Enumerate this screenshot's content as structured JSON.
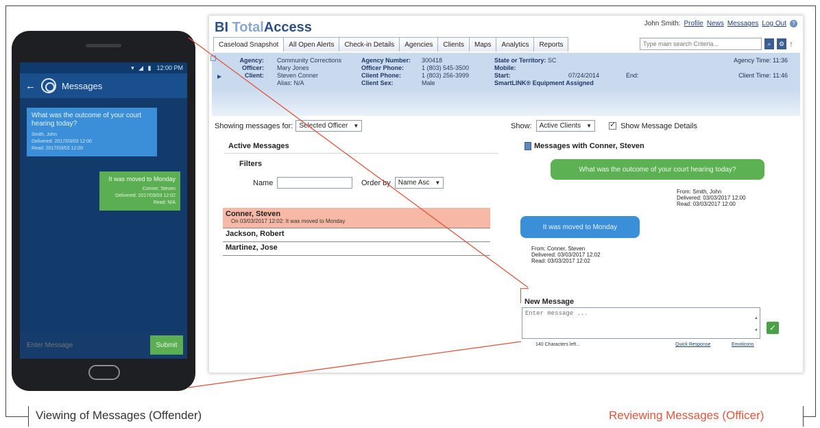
{
  "captions": {
    "left": "Viewing of Messages (Offender)",
    "right": "Reviewing Messages (Officer)"
  },
  "phone": {
    "status_time": "12:00 PM",
    "app_title": "Messages",
    "incoming": {
      "text": "What was the outcome of your court hearing today?",
      "from": "Smith, John",
      "delivered": "Delivered: 2017/03/03 12:00",
      "read": "Read: 2017/03/03 12:00"
    },
    "outgoing": {
      "text": "It was moved to Monday",
      "from": "Conner, Steven",
      "delivered": "Delivered: 2017/03/03 12:02",
      "read": "Read: N/A"
    },
    "input_placeholder": "Enter Message",
    "submit_label": "Submit"
  },
  "web": {
    "brand_bi": "BI",
    "brand_total": "Total",
    "brand_access": "Access",
    "user": {
      "name": "John Smith:",
      "links": [
        "Profile",
        "News",
        "Messages",
        "Log Out"
      ]
    },
    "tabs": [
      "Caseload Snapshot",
      "All Open Alerts",
      "Check-in Details",
      "Agencies",
      "Clients",
      "Maps",
      "Analytics",
      "Reports"
    ],
    "search_placeholder": "Type main search Criteria...",
    "header": {
      "agency_label": "Agency:",
      "agency_value": "Community Corrections",
      "officer_label": "Officer:",
      "officer_value": "Mary Jones",
      "client_label": "Client:",
      "client_value": "Steven Conner",
      "alias_value": "Alias: N/A",
      "agency_number_label": "Agency Number:",
      "agency_number_value": "300418",
      "officer_phone_label": "Officer Phone:",
      "officer_phone_value": "1 (803) 545-3500",
      "client_phone_label": "Client Phone:",
      "client_phone_value": "1 (803) 256-3999",
      "client_sex_label": "Client Sex:",
      "client_sex_value": "Male",
      "state_label": "State or Territory:",
      "state_value": "SC",
      "mobile_label": "Mobile:",
      "start_label": "Start:",
      "start_value": "07/24/2014",
      "end_label": "End:",
      "equipment": "SmartLINK® Equipment Assigned",
      "agency_time": "Agency Time: 11:36",
      "client_time": "Client Time: 11:46"
    },
    "showing_label": "Showing messages for:",
    "showing_value": "Selected Officer",
    "active_messages_title": "Active Messages",
    "filters_label": "Filters",
    "name_label": "Name",
    "order_label": "Order by",
    "order_value": "Name Asc",
    "clients": [
      {
        "name": "Conner, Steven",
        "preview": "On 03/03/2017 12:02: It was moved to Monday"
      },
      {
        "name": "Jackson, Robert",
        "preview": ""
      },
      {
        "name": "Martinez, Jose",
        "preview": ""
      }
    ],
    "show_label": "Show:",
    "show_value": "Active Clients",
    "show_details_label": "Show Message Details",
    "conversation_title": "Messages with Conner, Steven",
    "msg1": {
      "text": "What was the outcome of your court hearing today?",
      "from": "From: Smith, John",
      "delivered": "Delivered: 03/03/2017 12:00",
      "read": "Read: 03/03/2017 12:00"
    },
    "msg2": {
      "text": "It was moved to Monday",
      "from": "From: Conner, Steven",
      "delivered": "Delivered: 03/03/2017 12:02",
      "read": "Read: 03/03/2017 12:02"
    },
    "new_message_label": "New Message",
    "new_message_placeholder": "Enter message ...",
    "chars_left": "140 Characters left...",
    "quick_responses": "Quick Response",
    "emoticons": "Emoticons"
  },
  "colors": {
    "accent_red": "#e0553e",
    "bubble_green": "#5cb152",
    "bubble_blue": "#3b8fd8",
    "phone_bg": "#123a6b",
    "highlight_row": "#f8b8a6"
  }
}
